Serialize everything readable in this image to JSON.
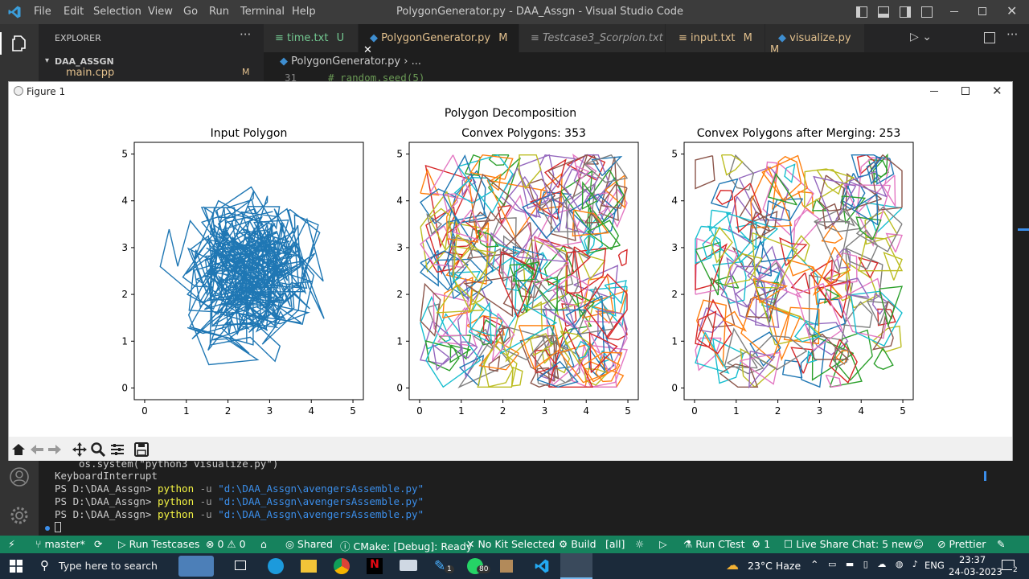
{
  "titlebar": {
    "menus": [
      "File",
      "Edit",
      "Selection",
      "View",
      "Go",
      "Run",
      "Terminal",
      "Help"
    ],
    "title": "PolygonGenerator.py - DAA_Assgn - Visual Studio Code"
  },
  "sidebar": {
    "header": "EXPLORER",
    "folder": "DAA_ASSGN",
    "file": "main.cpp",
    "file_badge": "M"
  },
  "tabs": [
    {
      "label": "time.txt",
      "badge": "U"
    },
    {
      "label": "PolygonGenerator.py",
      "badge": "M"
    },
    {
      "label": "Testcase3_Scorpion.txt",
      "badge": ""
    },
    {
      "label": "input.txt",
      "badge": "M"
    },
    {
      "label": "visualize.py",
      "badge": "M"
    }
  ],
  "editor": {
    "breadcrumb": "PolygonGenerator.py",
    "breadcrumb_more": "...",
    "line_number": "31",
    "line_code": "# random.seed(5)"
  },
  "figure": {
    "window_title": "Figure 1",
    "suptitle": "Polygon Decomposition"
  },
  "chart_data": [
    {
      "type": "line",
      "title": "Input Polygon",
      "xlim": [
        -0.25,
        5.25
      ],
      "ylim": [
        -0.25,
        5.25
      ],
      "xticks": [
        0,
        1,
        2,
        3,
        4,
        5
      ],
      "yticks": [
        0,
        1,
        2,
        3,
        4,
        5
      ],
      "series": [
        {
          "color": "#1f77b4",
          "points": "random polygon of ~1000 vertices in [0,5]x[0,5]"
        }
      ]
    },
    {
      "type": "line",
      "title": "Convex Polygons: 353",
      "xlim": [
        -0.25,
        5.25
      ],
      "ylim": [
        -0.25,
        5.25
      ],
      "xticks": [
        0,
        1,
        2,
        3,
        4,
        5
      ],
      "yticks": [
        0,
        1,
        2,
        3,
        4,
        5
      ],
      "polygon_count": 353
    },
    {
      "type": "line",
      "title": "Convex Polygons after Merging: 253",
      "xlim": [
        -0.25,
        5.25
      ],
      "ylim": [
        -0.25,
        5.25
      ],
      "xticks": [
        0,
        1,
        2,
        3,
        4,
        5
      ],
      "yticks": [
        0,
        1,
        2,
        3,
        4,
        5
      ],
      "polygon_count": 253
    }
  ],
  "terminal": {
    "lines": [
      "os.system(\"python3 visualize.py\")",
      "KeyboardInterrupt"
    ],
    "prompt": "PS D:\\DAA_Assgn>",
    "cmd": "python",
    "flag": "-u",
    "arg": "\"d:\\DAA_Assgn\\avengersAssemble.py\""
  },
  "statusbar": {
    "branch": "master*",
    "run_testcases": "Run Testcases",
    "problems": "0",
    "warnings": "0",
    "shared": "Shared",
    "cmake": "CMake: [Debug]: Ready",
    "kit": "No Kit Selected",
    "build": "Build",
    "all": "[all]",
    "ctest": "Run CTest",
    "one": "1",
    "liveshare": "Live Share Chat: 5 new",
    "prettier": "Prettier"
  },
  "taskbar": {
    "search": "Type here to search",
    "weather": "23°C Haze",
    "lang": "ENG",
    "time": "23:37",
    "date": "24-03-2023",
    "badge_80": "80",
    "badge_1": "1",
    "notif": "2"
  },
  "colors": {
    "cycle": [
      "#1f77b4",
      "#ff7f0e",
      "#2ca02c",
      "#d62728",
      "#9467bd",
      "#8c564b",
      "#e377c2",
      "#7f7f7f",
      "#bcbd22",
      "#17becf"
    ]
  }
}
